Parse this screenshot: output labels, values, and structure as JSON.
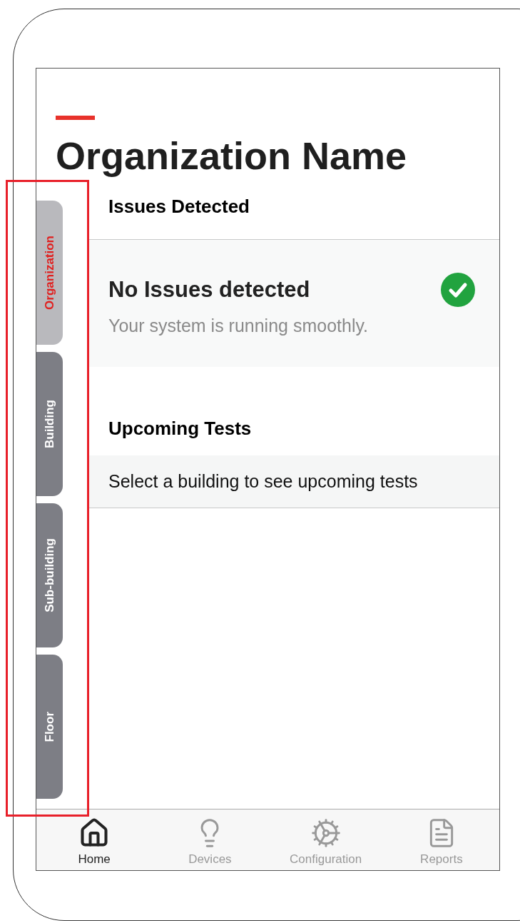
{
  "title": "Organization Name",
  "tabs": [
    {
      "label": "Organization",
      "selected": true
    },
    {
      "label": "Building",
      "selected": false
    },
    {
      "label": "Sub-building",
      "selected": false
    },
    {
      "label": "Floor",
      "selected": false
    }
  ],
  "issues": {
    "heading": "Issues Detected",
    "status_title": "No Issues detected",
    "status_text": "Your system is running smoothly."
  },
  "upcoming": {
    "heading": "Upcoming Tests",
    "message": "Select a building to see upcoming tests"
  },
  "nav": [
    {
      "label": "Home",
      "selected": true
    },
    {
      "label": "Devices",
      "selected": false
    },
    {
      "label": "Configuration",
      "selected": false
    },
    {
      "label": "Reports",
      "selected": false
    }
  ]
}
